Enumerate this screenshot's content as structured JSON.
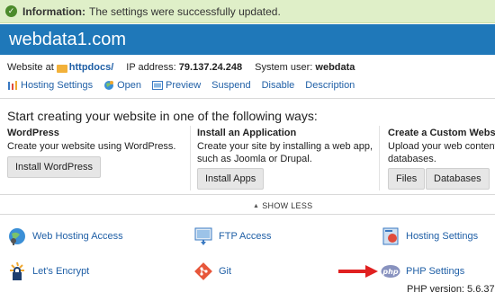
{
  "notice": {
    "label": "Information:",
    "message": "The settings were successfully updated."
  },
  "header": {
    "title": "webdata1.com"
  },
  "info": {
    "website_at_label": "Website at",
    "website_folder": "httpdocs/",
    "ip_label": "IP address:",
    "ip_value": "79.137.24.248",
    "user_label": "System user:",
    "user_value": "webdata"
  },
  "actions": [
    {
      "label": "Hosting Settings",
      "icon": "hosting-settings-icon"
    },
    {
      "label": "Open",
      "icon": "globe-icon"
    },
    {
      "label": "Preview",
      "icon": "preview-icon"
    },
    {
      "label": "Suspend"
    },
    {
      "label": "Disable"
    },
    {
      "label": "Description"
    }
  ],
  "start": {
    "title": "Start creating your website in one of the following ways:",
    "columns": [
      {
        "heading": "WordPress",
        "desc": [
          "Create your website using WordPress."
        ],
        "buttons": [
          "Install WordPress"
        ]
      },
      {
        "heading": "Install an Application",
        "desc": [
          "Create your site by installing a web app,",
          "such as Joomla or Drupal."
        ],
        "buttons": [
          "Install Apps"
        ]
      },
      {
        "heading": "Create a Custom Website",
        "desc": [
          "Upload your web content a",
          "databases."
        ],
        "buttons": [
          "Files",
          "Databases"
        ]
      }
    ]
  },
  "show_less": "SHOW LESS",
  "tools": [
    {
      "label": "Web Hosting Access",
      "icon": "web-hosting-access-icon"
    },
    {
      "label": "FTP Access",
      "icon": "ftp-access-icon"
    },
    {
      "label": "Hosting Settings",
      "icon": "hosting-settings-icon"
    },
    {
      "label": "Let's Encrypt",
      "icon": "lets-encrypt-icon"
    },
    {
      "label": "Git",
      "icon": "git-icon"
    },
    {
      "label": "PHP Settings",
      "icon": "php-icon"
    }
  ],
  "php_version": "PHP version: 5.6.37",
  "colors": {
    "header": "#1f78b9",
    "link": "#1f5fa6",
    "notice_bg": "#dfefc8",
    "arrow": "#e02020"
  }
}
